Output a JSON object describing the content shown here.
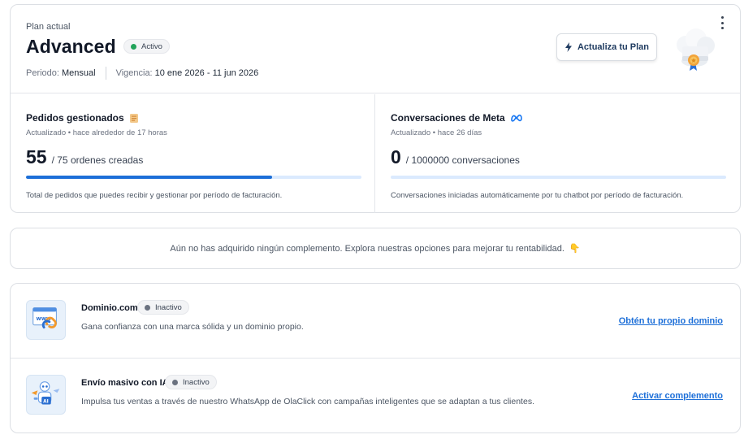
{
  "plan": {
    "label": "Plan actual",
    "name": "Advanced",
    "status": "Activo",
    "status_color": "#22a35a",
    "period_label": "Periodo:",
    "period_value": "Mensual",
    "validity_label": "Vigencia:",
    "validity_value": "10 ene 2026 - 11 jun 2026",
    "upgrade_label": "Actualiza tu Plan",
    "upgrade_icon": "lightning-icon",
    "menu_icon": "kebab-menu-icon",
    "mascot_icon": "chef-hat-medal-icon"
  },
  "stats": {
    "orders": {
      "title": "Pedidos gestionados",
      "icon": "receipt-icon",
      "updated": "Actualizado • hace alrededor de 17 horas",
      "value": "55",
      "unit": "/ 75 ordenes creadas",
      "progress_fraction": 0.733,
      "description": "Total de pedidos que puedes recibir y gestionar por período de facturación."
    },
    "conversations": {
      "title": "Conversaciones de Meta",
      "icon": "meta-logo-icon",
      "updated": "Actualizado • hace 26 días",
      "value": "0",
      "unit": "/ 1000000 conversaciones",
      "progress_fraction": 0,
      "description": "Conversaciones iniciadas automáticamente por tu chatbot por período de facturación."
    }
  },
  "notice": {
    "text": "Aún no has adquirido ningún complemento. Explora nuestras opciones para mejorar tu rentabilidad.",
    "emoji": "👇"
  },
  "addons": [
    {
      "title": "Dominio.com",
      "status": "Inactivo",
      "status_color": "#6b7280",
      "description": "Gana confianza con una marca sólida y un dominio propio.",
      "link": "Obtén tu propio dominio",
      "icon": "www-link-icon"
    },
    {
      "title": "Envío masivo con IA",
      "status": "Inactivo",
      "status_color": "#6b7280",
      "description": "Impulsa tus ventas a través de nuestro WhatsApp de OlaClick con campañas inteligentes que se adaptan a tus clientes.",
      "link": "Activar complemento",
      "icon": "ai-robot-icon"
    }
  ],
  "colors": {
    "accent": "#1d6fd8",
    "progress_track": "#dbeafe",
    "border": "#dcdfe4"
  }
}
